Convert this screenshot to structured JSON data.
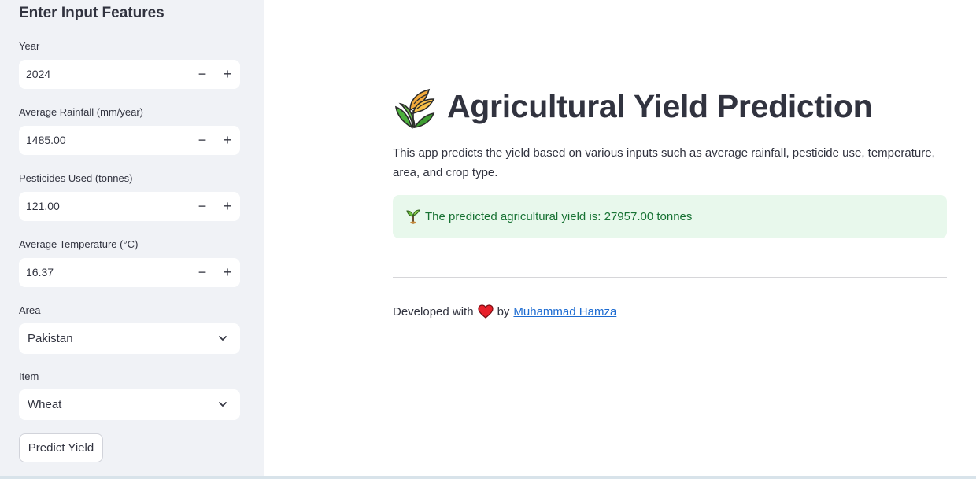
{
  "sidebar": {
    "title": "Enter Input Features",
    "fields": [
      {
        "label": "Year",
        "value": "2024"
      },
      {
        "label": "Average Rainfall (mm/year)",
        "value": "1485.00"
      },
      {
        "label": "Pesticides Used (tonnes)",
        "value": "121.00"
      },
      {
        "label": "Average Temperature (°C)",
        "value": "16.37"
      }
    ],
    "stepper": {
      "minus": "−",
      "plus": "+"
    },
    "area": {
      "label": "Area",
      "value": "Pakistan"
    },
    "item": {
      "label": "Item",
      "value": "Wheat"
    },
    "predict_button": "Predict Yield"
  },
  "main": {
    "title": "Agricultural Yield Prediction",
    "title_icon": "wheat-sheaf-icon",
    "description": "This app predicts the yield based on various inputs such as average rainfall, pesticide use, temperature, area, and crop type.",
    "result": {
      "icon": "seedling-icon",
      "text": "The predicted agricultural yield is: 27957.00 tonnes"
    },
    "footer": {
      "prefix": "Developed with",
      "icon": "heart-icon",
      "middle": "by",
      "author": "Muhammad Hamza"
    }
  },
  "colors": {
    "sidebar_bg": "#f0f2f6",
    "success_bg": "#e8f8ec",
    "success_text": "#177233",
    "link": "#1c6bd1"
  }
}
